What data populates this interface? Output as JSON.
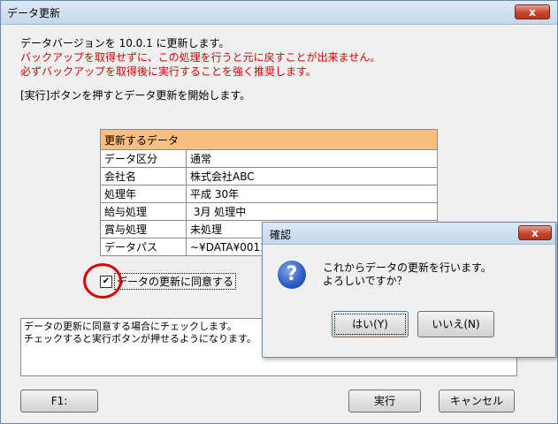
{
  "window": {
    "title": "データ更新",
    "close_label": "x"
  },
  "message": {
    "line1": "データバージョンを 10.0.1 に更新します。",
    "warning1": "バックアップを取得せずに、この処理を行うと元に戻すことが出来ません。",
    "warning2": "必ずバックアップを取得後に実行することを強く推奨します。",
    "instruction": "[実行]ボタンを押すとデータ更新を開始します。"
  },
  "table": {
    "header": "更新するデータ",
    "rows": [
      {
        "label": "データ区分",
        "value": "通常"
      },
      {
        "label": "会社名",
        "value": "株式会社ABC"
      },
      {
        "label": "処理年",
        "value": "平成 30年"
      },
      {
        "label": "給与処理",
        "value": " 3月 処理中"
      },
      {
        "label": "賞与処理",
        "value": "未処理"
      },
      {
        "label": "データパス",
        "value": "~¥DATA¥0011"
      }
    ]
  },
  "agree": {
    "checked": true,
    "check_mark": "✔",
    "label": "データの更新に同意する"
  },
  "memo": {
    "line1": "データの更新に同意する場合にチェックします。",
    "line2": "チェックすると実行ボタンが押せるようになります。"
  },
  "buttons": {
    "f1": "F1:",
    "run": "実行",
    "cancel": "キャンセル"
  },
  "dialog": {
    "title": "確認",
    "close_label": "x",
    "icon": "?",
    "line1": "これからデータの更新を行います。",
    "line2": "よろしいですか？",
    "yes": "はい(Y)",
    "no": "いいえ(N)"
  },
  "colors": {
    "table_header": "#f9be82",
    "warning_text": "#e00000",
    "highlight_circle": "#e00000"
  }
}
